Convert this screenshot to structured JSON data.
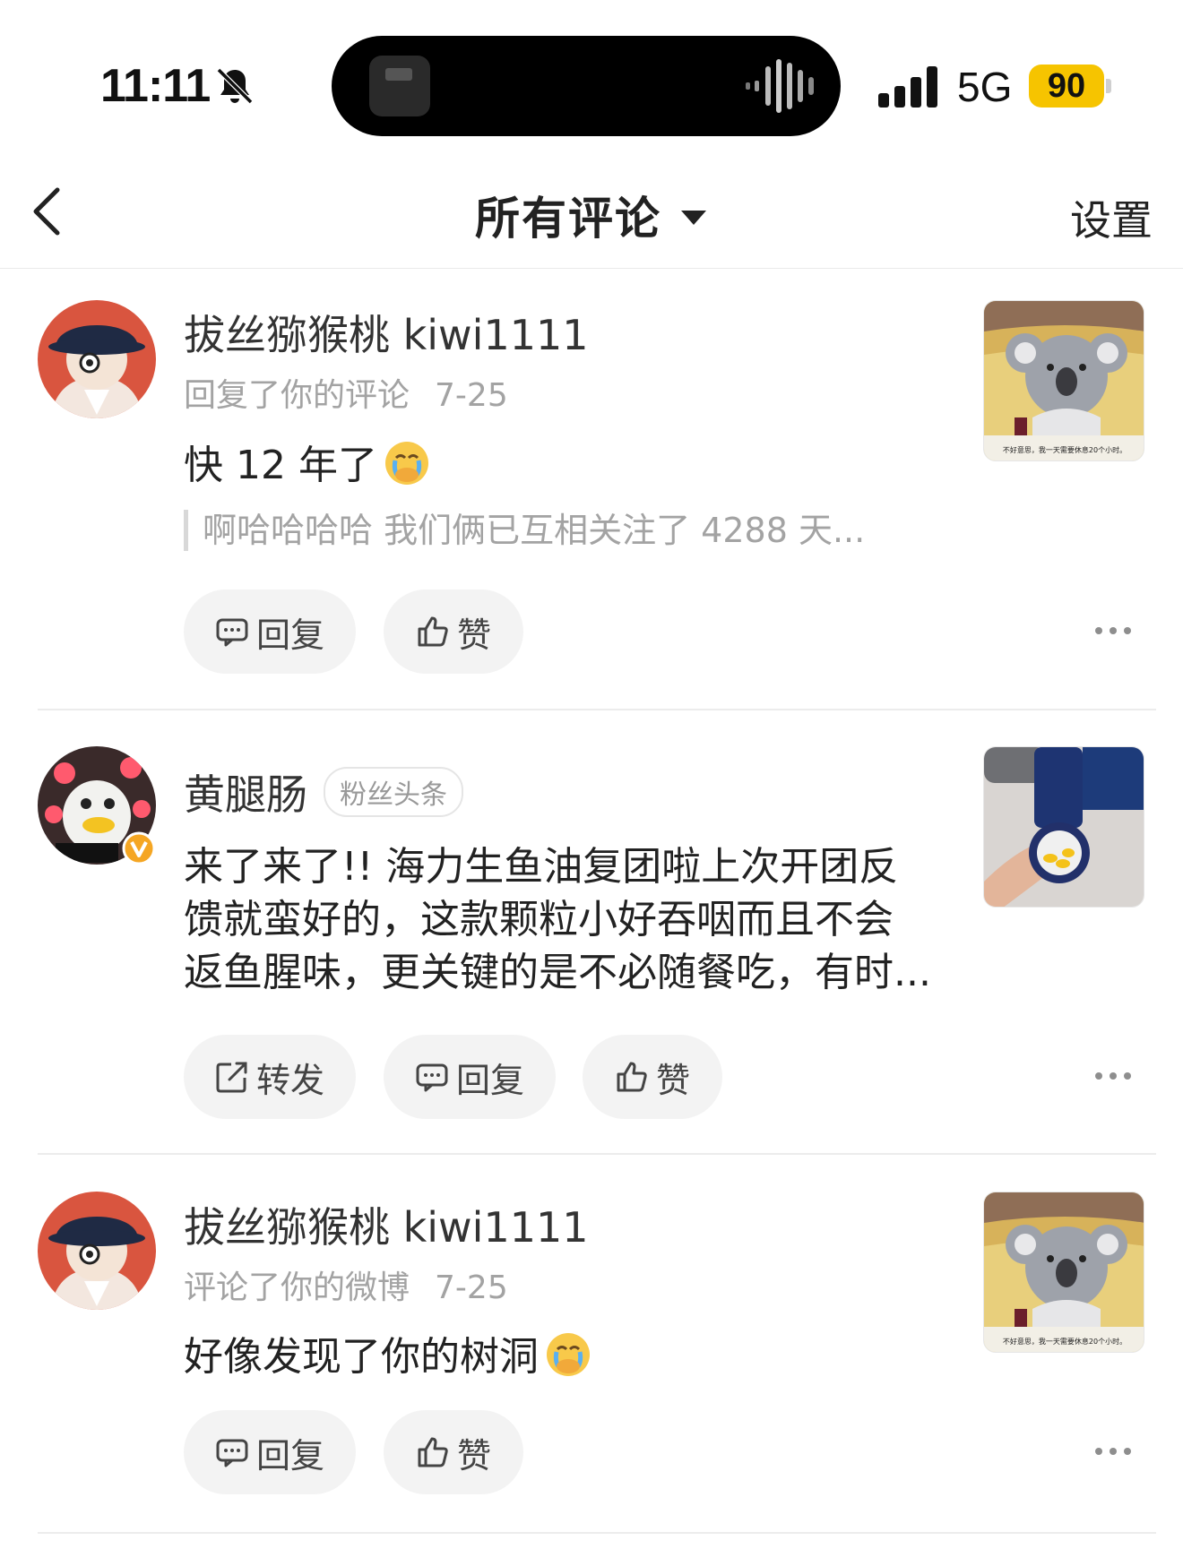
{
  "status_bar": {
    "time": "11:11",
    "mute_icon": "bell-slash-icon",
    "network": "5G",
    "battery": "90",
    "battery_color": "#f6c400"
  },
  "nav": {
    "title": "所有评论",
    "settings_label": "设置"
  },
  "comments": [
    {
      "user": "拔丝猕猴桃 kiwi1111",
      "meta_action": "回复了你的评论",
      "date": "7-25",
      "text": "快 12 年了",
      "emoji": "crying-face",
      "quote": "啊哈哈哈哈 我们俩已互相关注了 4288 天...",
      "actions": [
        "回复",
        "赞"
      ]
    },
    {
      "user": "黄腿肠",
      "badge": "粉丝头条",
      "verified": true,
      "text_lines": [
        "来了来了!! 海力生鱼油复团啦上次开团反",
        "馈就蛮好的，这款颗粒小好吞咽而且不会",
        "返鱼腥味，更关键的是不必随餐吃，有时..."
      ],
      "actions": [
        "转发",
        "回复",
        "赞"
      ]
    },
    {
      "user": "拔丝猕猴桃 kiwi1111",
      "meta_action": "评论了你的微博",
      "date": "7-25",
      "text": "好像发现了你的树洞",
      "emoji": "crying-face",
      "actions": [
        "回复",
        "赞"
      ]
    }
  ],
  "thumb_caption": "不好意思，我一天需要休息20个小时。"
}
